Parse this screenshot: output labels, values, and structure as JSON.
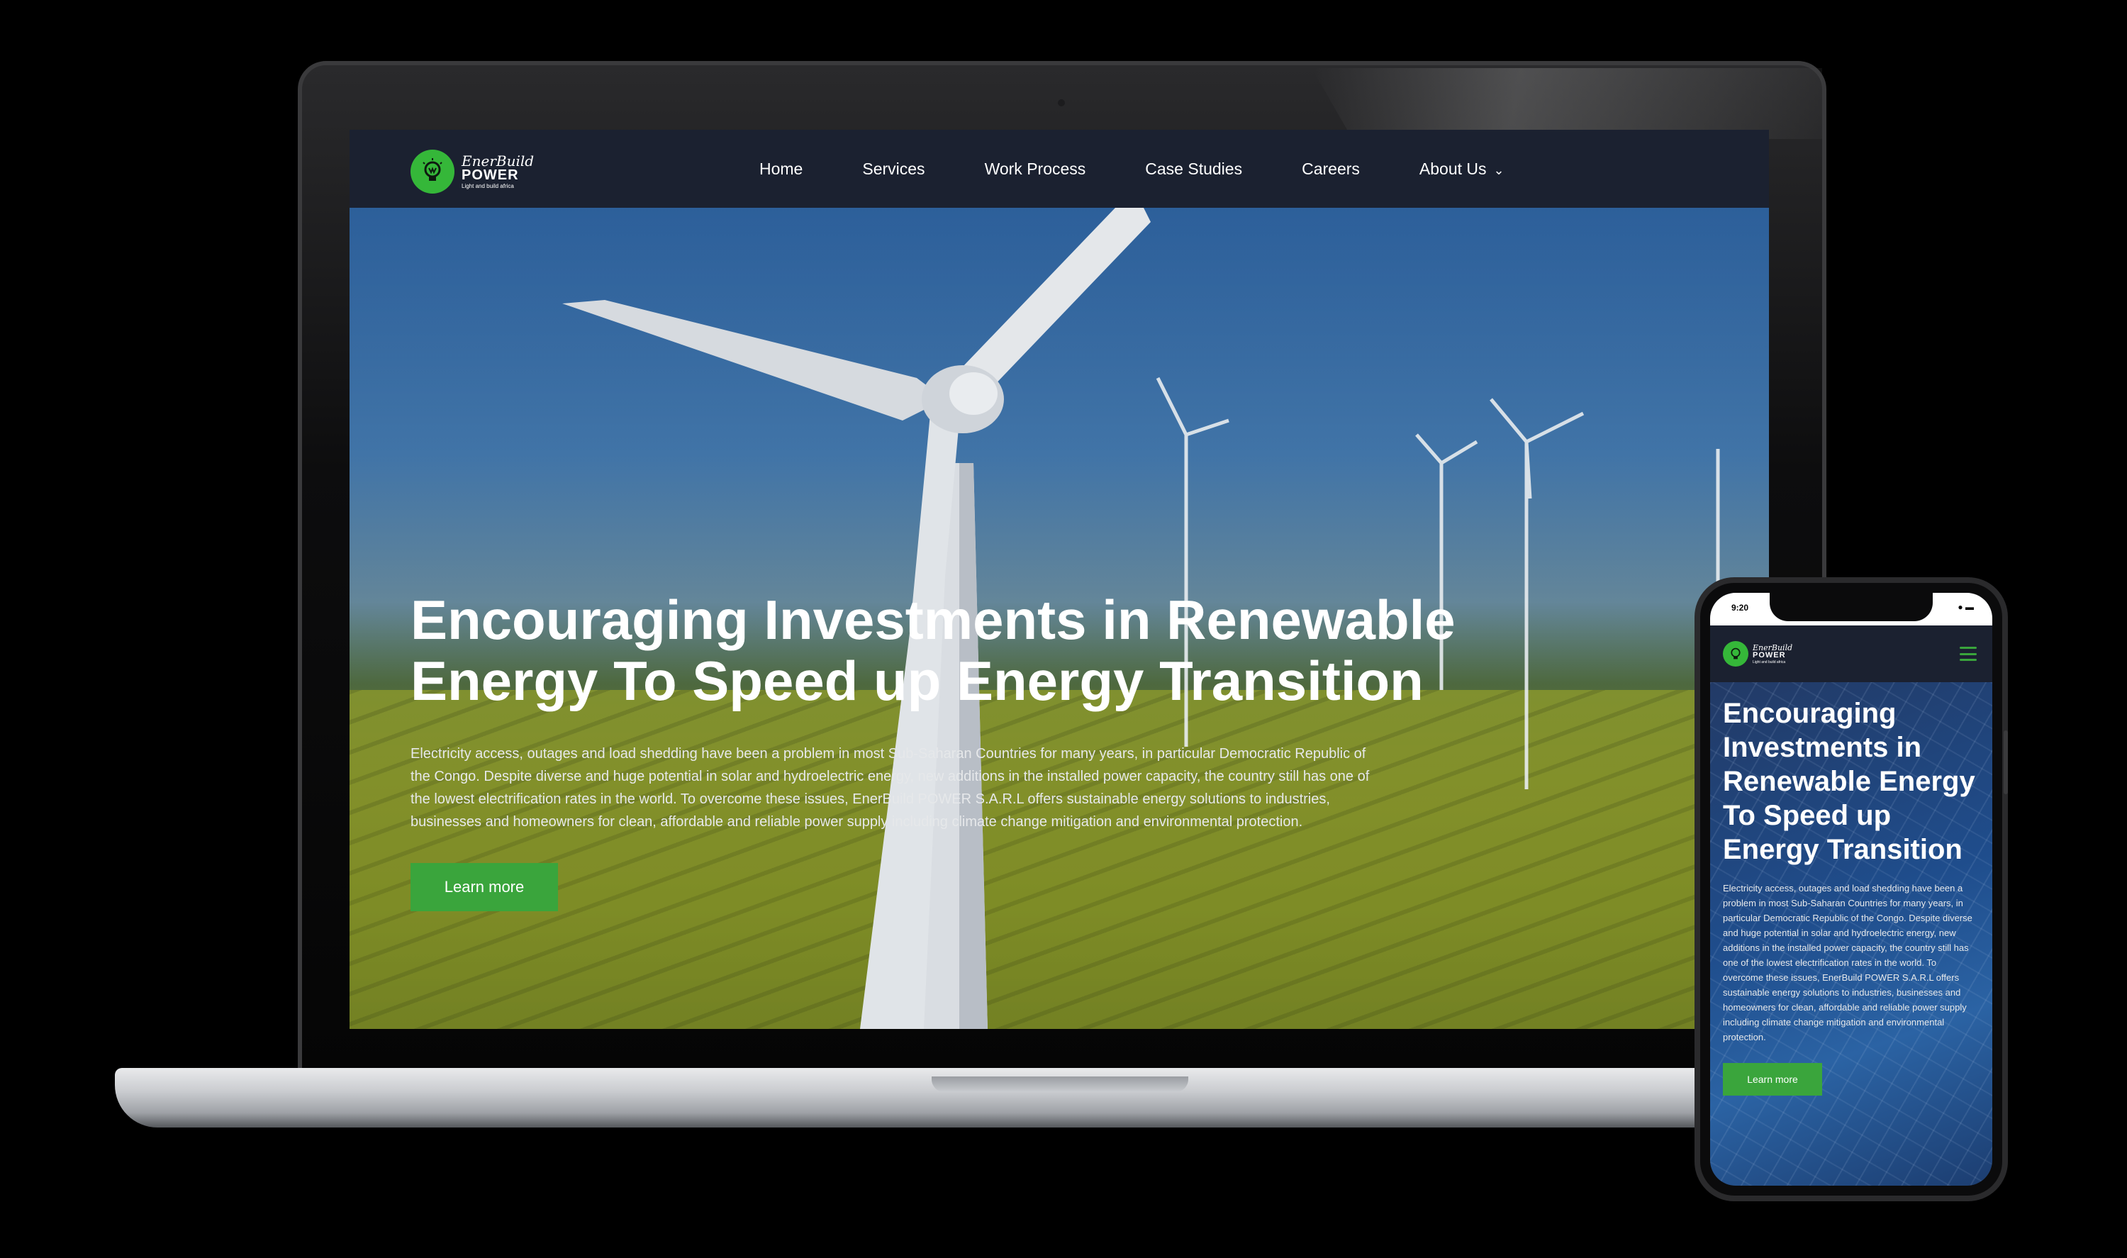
{
  "brand": {
    "name_script": "EnerBuild",
    "name_bold": "POWER",
    "tagline": "Light and build africa",
    "accent": "#3aa53c",
    "logo_icon": "lightbulb-icon"
  },
  "nav": {
    "items": [
      {
        "label": "Home"
      },
      {
        "label": "Services"
      },
      {
        "label": "Work Process"
      },
      {
        "label": "Case Studies"
      },
      {
        "label": "Careers"
      },
      {
        "label": "About Us",
        "dropdown": true
      }
    ]
  },
  "hero": {
    "title": "Encouraging Investments in Renewable Energy To Speed up Energy Transition",
    "description": "Electricity access, outages and load shedding have been a problem in most Sub-Saharan Countries for many years, in particular Democratic Republic of the Congo. Despite diverse and huge potential in solar and hydroelectric energy, new additions in the installed power capacity, the country still has one of the lowest electrification rates in the world. To overcome these issues, EnerBuild POWER S.A.R.L offers sustainable energy solutions to industries, businesses and homeowners for clean, affordable and reliable power supply including climate change mitigation and environmental protection.",
    "button_label": "Learn more"
  },
  "phone": {
    "status_time": "9:20",
    "menu_icon": "hamburger-icon"
  }
}
